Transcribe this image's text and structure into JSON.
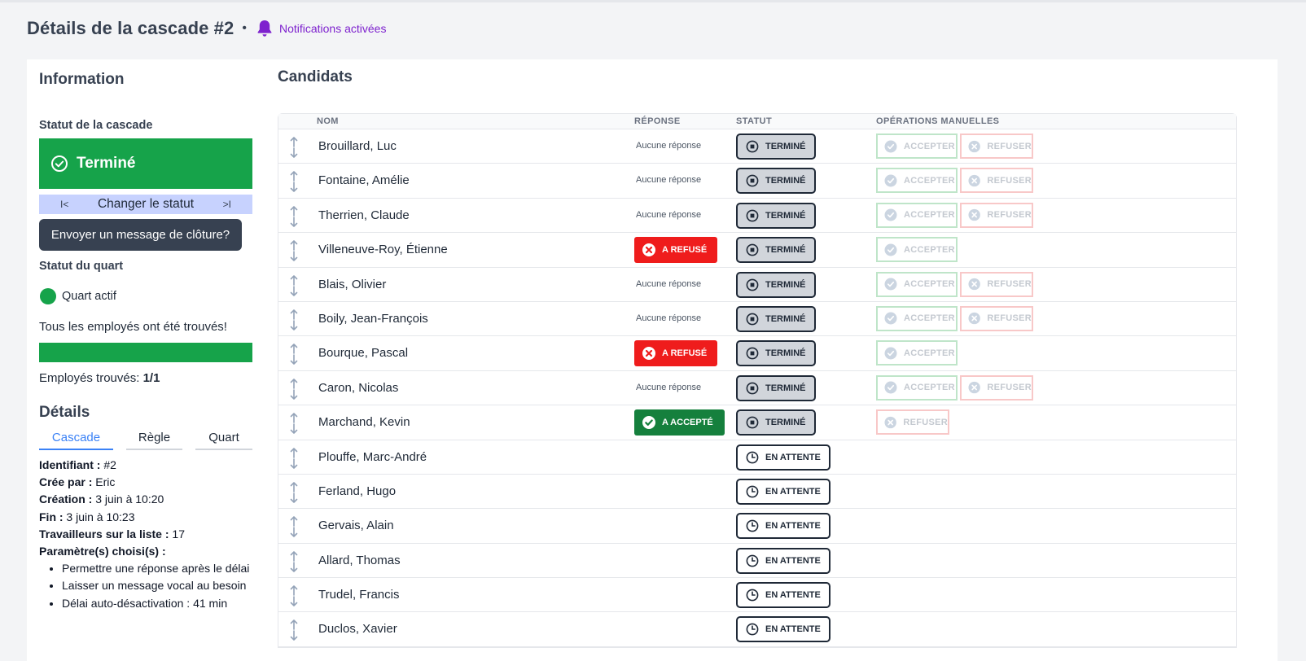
{
  "header": {
    "title": "Détails de la cascade #2",
    "separator": "•",
    "notification_label": "Notifications activées"
  },
  "colors": {
    "accent_purple": "#7e22ce",
    "success": "#16a34a",
    "refused": "#ef1c1c",
    "accepted": "#15803d"
  },
  "info": {
    "heading": "Information",
    "cascade_status_label": "Statut de la cascade",
    "cascade_status_value": "Terminé",
    "change_status_label": "Changer le statut",
    "closure_button": "Envoyer un message de clôture?",
    "shift_status_label": "Statut du quart",
    "shift_status_value": "Quart actif",
    "found_message": "Tous les employés ont été trouvés!",
    "progress_fraction": 1.0,
    "found_label": "Employés trouvés: ",
    "found_count": "1/1"
  },
  "details": {
    "heading": "Détails",
    "tabs": [
      "Cascade",
      "Règle",
      "Quart"
    ],
    "active_tab": "Cascade",
    "id_label": "Identifiant :",
    "id_value": " #2",
    "created_by_label": "Crée par :",
    "created_by_value": " Eric",
    "created_label": "Création :",
    "created_value": " 3 juin à 10:20",
    "end_label": "Fin :",
    "end_value": " 3 juin à 10:23",
    "workers_label": "Travailleurs sur la liste :",
    "workers_value": " 17",
    "params_label": "Paramètre(s) choisi(s) :",
    "params": [
      "Permettre une réponse après le délai",
      "Laisser un message vocal au besoin",
      "Délai auto-désactivation : 41 min"
    ]
  },
  "candidates": {
    "heading": "Candidats",
    "columns": [
      "NOM",
      "RÉPONSE",
      "STATUT",
      "OPÉRATIONS MANUELLES"
    ],
    "rows": [
      {
        "name": "Brouillard, Luc",
        "response": "none",
        "response_text": "Aucune réponse",
        "status": "done",
        "status_text": "TERMINÉ",
        "ops": [
          "ACCEPTER",
          "REFUSER"
        ]
      },
      {
        "name": "Fontaine, Amélie",
        "response": "none",
        "response_text": "Aucune réponse",
        "status": "done",
        "status_text": "TERMINÉ",
        "ops": [
          "ACCEPTER",
          "REFUSER"
        ]
      },
      {
        "name": "Therrien, Claude",
        "response": "none",
        "response_text": "Aucune réponse",
        "status": "done",
        "status_text": "TERMINÉ",
        "ops": [
          "ACCEPTER",
          "REFUSER"
        ]
      },
      {
        "name": "Villeneuve-Roy, Étienne",
        "response": "refused",
        "response_text": "A REFUSÉ",
        "status": "done",
        "status_text": "TERMINÉ",
        "ops": [
          "ACCEPTER"
        ]
      },
      {
        "name": "Blais, Olivier",
        "response": "none",
        "response_text": "Aucune réponse",
        "status": "done",
        "status_text": "TERMINÉ",
        "ops": [
          "ACCEPTER",
          "REFUSER"
        ]
      },
      {
        "name": "Boily, Jean-François",
        "response": "none",
        "response_text": "Aucune réponse",
        "status": "done",
        "status_text": "TERMINÉ",
        "ops": [
          "ACCEPTER",
          "REFUSER"
        ]
      },
      {
        "name": "Bourque, Pascal",
        "response": "refused",
        "response_text": "A REFUSÉ",
        "status": "done",
        "status_text": "TERMINÉ",
        "ops": [
          "ACCEPTER"
        ]
      },
      {
        "name": "Caron, Nicolas",
        "response": "none",
        "response_text": "Aucune réponse",
        "status": "done",
        "status_text": "TERMINÉ",
        "ops": [
          "ACCEPTER",
          "REFUSER"
        ]
      },
      {
        "name": "Marchand, Kevin",
        "response": "accepted",
        "response_text": "A ACCEPTÉ",
        "status": "done",
        "status_text": "TERMINÉ",
        "ops": [
          "REFUSER"
        ]
      },
      {
        "name": "Plouffe, Marc-André",
        "response": "",
        "response_text": "",
        "status": "wait",
        "status_text": "EN ATTENTE",
        "ops": []
      },
      {
        "name": "Ferland, Hugo",
        "response": "",
        "response_text": "",
        "status": "wait",
        "status_text": "EN ATTENTE",
        "ops": []
      },
      {
        "name": "Gervais, Alain",
        "response": "",
        "response_text": "",
        "status": "wait",
        "status_text": "EN ATTENTE",
        "ops": []
      },
      {
        "name": "Allard, Thomas",
        "response": "",
        "response_text": "",
        "status": "wait",
        "status_text": "EN ATTENTE",
        "ops": []
      },
      {
        "name": "Trudel, Francis",
        "response": "",
        "response_text": "",
        "status": "wait",
        "status_text": "EN ATTENTE",
        "ops": []
      },
      {
        "name": "Duclos, Xavier",
        "response": "",
        "response_text": "",
        "status": "wait",
        "status_text": "EN ATTENTE",
        "ops": []
      }
    ]
  }
}
